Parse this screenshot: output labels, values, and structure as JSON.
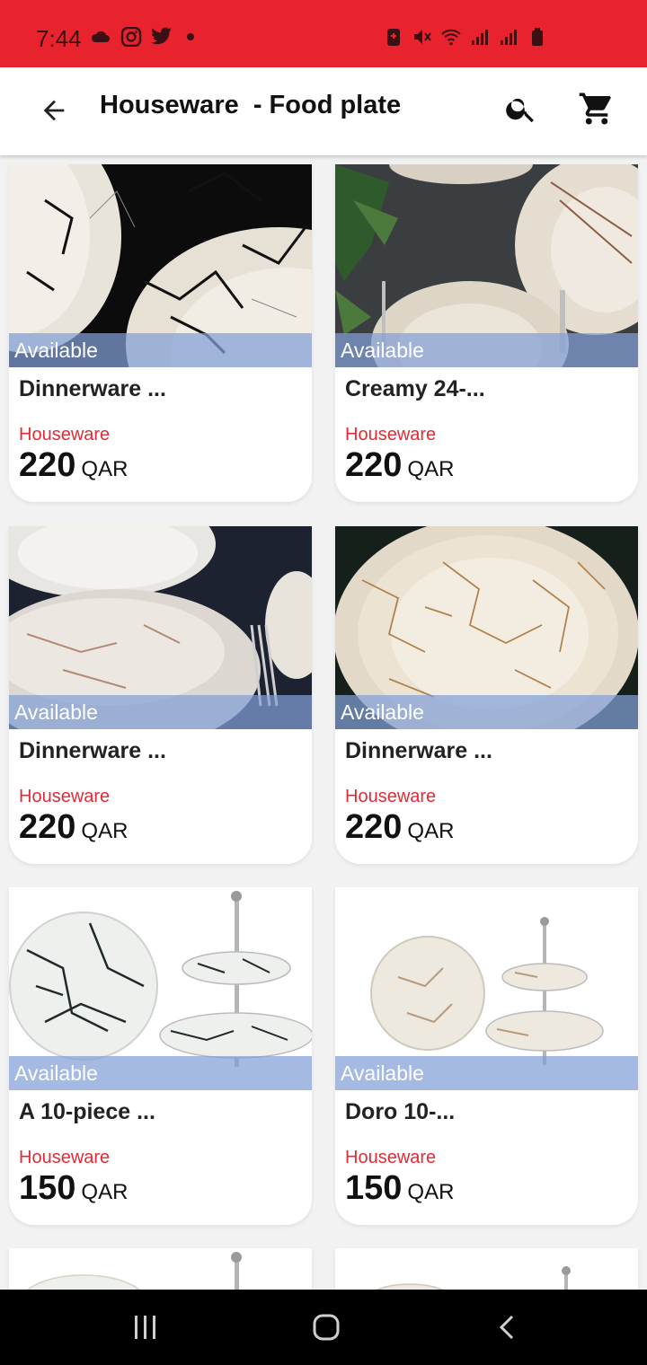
{
  "status_bar": {
    "time": "7:44",
    "left_icons": [
      "cloud-icon",
      "instagram-icon",
      "twitter-icon",
      "dot-icon"
    ],
    "right_icons": [
      "alarm-icon",
      "mute-icon",
      "wifi-icon",
      "signal-icon",
      "signal-icon",
      "battery-icon"
    ]
  },
  "app_bar": {
    "title": "Houseware  - Food plate",
    "back_icon": "arrow-left-icon",
    "search_icon": "search-icon",
    "cart_icon": "cart-icon"
  },
  "colors": {
    "status_bar_bg": "#e8232e",
    "accent_red": "#e02b36",
    "badge_blue": "#82a0d7"
  },
  "products": [
    {
      "name": "Dinnerware ...",
      "category": "Houseware",
      "price": "220",
      "currency": "QAR",
      "badge": "Available"
    },
    {
      "name": "Creamy 24-...",
      "category": "Houseware",
      "price": "220",
      "currency": "QAR",
      "badge": "Available"
    },
    {
      "name": "Dinnerware ...",
      "category": "Houseware",
      "price": "220",
      "currency": "QAR",
      "badge": "Available"
    },
    {
      "name": "Dinnerware ...",
      "category": "Houseware",
      "price": "220",
      "currency": "QAR",
      "badge": "Available"
    },
    {
      "name": "A 10-piece ...",
      "category": "Houseware",
      "price": "150",
      "currency": "QAR",
      "badge": "Available"
    },
    {
      "name": "Doro 10-...",
      "category": "Houseware",
      "price": "150",
      "currency": "QAR",
      "badge": "Available"
    }
  ],
  "nav_bar": {
    "recents_icon": "recents-icon",
    "home_icon": "home-icon",
    "back_icon": "nav-back-icon"
  }
}
